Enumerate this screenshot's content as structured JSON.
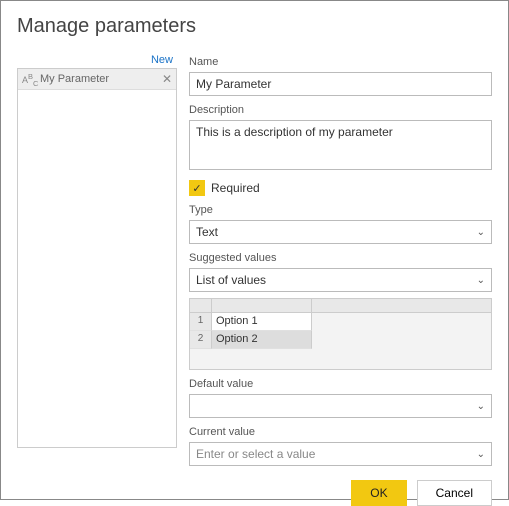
{
  "title": "Manage parameters",
  "sidebar": {
    "new_link": "New",
    "items": [
      {
        "label": "My Parameter"
      }
    ]
  },
  "form": {
    "name_label": "Name",
    "name_value": "My Parameter",
    "desc_label": "Description",
    "desc_value": "This is a description of my parameter",
    "required_label": "Required",
    "type_label": "Type",
    "type_value": "Text",
    "suggested_label": "Suggested values",
    "suggested_value": "List of values",
    "values": [
      {
        "index": "1",
        "value": "Option 1"
      },
      {
        "index": "2",
        "value": "Option 2"
      }
    ],
    "default_label": "Default value",
    "default_value": "",
    "current_label": "Current value",
    "current_placeholder": "Enter or select a value"
  },
  "footer": {
    "ok": "OK",
    "cancel": "Cancel"
  }
}
